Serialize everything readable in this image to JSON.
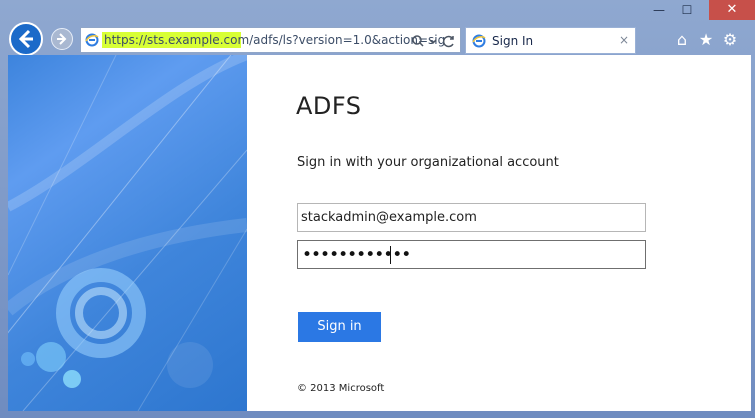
{
  "browser": {
    "window_controls": {
      "minimize": "—",
      "maximize": "☐",
      "close": "✕"
    },
    "address_bar": {
      "url": "https://sts.example.com/adfs/ls?version=1.0&action=sig"
    },
    "tab": {
      "title": "Sign In",
      "close": "×"
    },
    "icons": {
      "home": "⌂",
      "favorites": "★",
      "settings": "⚙"
    }
  },
  "page": {
    "brand": "ADFS",
    "subtitle": "Sign in with your organizational account",
    "email_value": "stackadmin@example.com",
    "password_mask": "••••••••••••",
    "sign_in_button": "Sign in",
    "footer": "© 2013 Microsoft"
  },
  "colors": {
    "accent": "#2b78e4",
    "art_blue": "#3d84dd",
    "chrome_blue": "#7f97bf"
  }
}
